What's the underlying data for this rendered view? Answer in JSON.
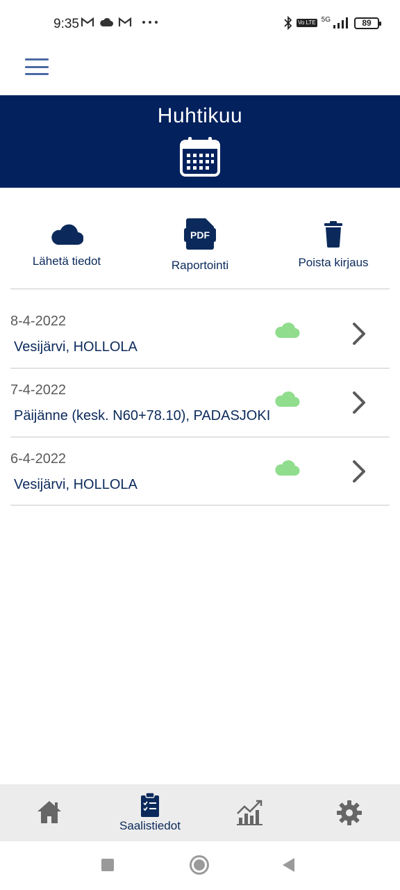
{
  "status_bar": {
    "time": "9:35",
    "left_icons": [
      "gmail-icon",
      "cloud-icon",
      "gmail-icon",
      "more-icon"
    ],
    "network": "5G",
    "volte": "Vo LTE",
    "battery": "89"
  },
  "header": {
    "menu_icon": "hamburger-menu-icon",
    "month": "Huhtikuu",
    "calendar_icon": "calendar-icon"
  },
  "actions": {
    "send": {
      "label": "Lähetä tiedot",
      "icon": "cloud-upload-icon"
    },
    "report": {
      "label": "Raportointi",
      "icon": "pdf-icon",
      "icon_text": "PDF"
    },
    "delete": {
      "label": "Poista kirjaus",
      "icon": "trash-icon"
    }
  },
  "entries": [
    {
      "date": "8-4-2022",
      "place": "Vesijärvi, HOLLOLA",
      "synced_icon": "cloud-synced-icon"
    },
    {
      "date": "7-4-2022",
      "place": "Päijänne (kesk. N60+78.10), PADASJOKI",
      "synced_icon": "cloud-synced-icon"
    },
    {
      "date": "6-4-2022",
      "place": "Vesijärvi, HOLLOLA",
      "synced_icon": "cloud-synced-icon"
    }
  ],
  "bottom_nav": {
    "home_icon": "home-icon",
    "catch": {
      "label": "Saalistiedot",
      "icon": "clipboard-check-icon"
    },
    "stats_icon": "chart-icon",
    "settings_icon": "gear-icon"
  },
  "colors": {
    "primary": "#03215d",
    "text_dark": "#0b2a5b",
    "synced_cloud": "#90dd8e",
    "divider": "#c9c9c9",
    "nav_bg": "#ececec"
  }
}
